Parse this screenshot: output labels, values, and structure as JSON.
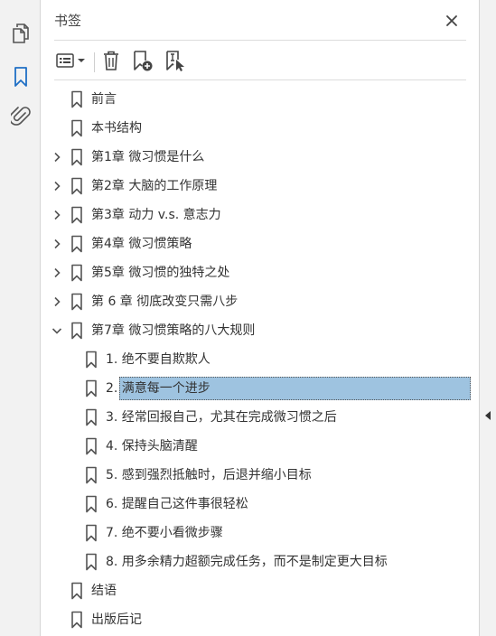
{
  "panel": {
    "title": "书签"
  },
  "toolbar": {
    "options_icon": "list-options-icon",
    "delete_icon": "trash-icon",
    "new_bookmark_icon": "new-bookmark-icon",
    "bookmark_from_selection_icon": "bookmark-selection-icon"
  },
  "left_rail": {
    "items": [
      {
        "icon": "pages-icon"
      },
      {
        "icon": "bookmark-icon",
        "active": true
      },
      {
        "icon": "attachment-icon"
      }
    ]
  },
  "colors": {
    "accent": "#1f6fc5",
    "selection": "#9ec3e0",
    "icon": "#444444"
  },
  "bookmarks": [
    {
      "label": "前言",
      "level": 0,
      "expander": "none"
    },
    {
      "label": "本书结构",
      "level": 0,
      "expander": "none"
    },
    {
      "label": "第1章 微习惯是什么",
      "level": 0,
      "expander": "collapsed"
    },
    {
      "label": "第2章 大脑的工作原理",
      "level": 0,
      "expander": "collapsed"
    },
    {
      "label": "第3章 动力 v.s. 意志力",
      "level": 0,
      "expander": "collapsed"
    },
    {
      "label": "第4章 微习惯策略",
      "level": 0,
      "expander": "collapsed"
    },
    {
      "label": "第5章 微习惯的独特之处",
      "level": 0,
      "expander": "collapsed"
    },
    {
      "label": "第 6 章 彻底改变只需八步",
      "level": 0,
      "expander": "collapsed"
    },
    {
      "label": "第7章 微习惯策略的八大规则",
      "level": 0,
      "expander": "expanded"
    },
    {
      "label": "1. 绝不要自欺欺人",
      "level": 1,
      "expander": "none"
    },
    {
      "label": "2. 满意每一个进步",
      "level": 1,
      "expander": "none",
      "selected": true
    },
    {
      "label": "3. 经常回报自己，尤其在完成微习惯之后",
      "level": 1,
      "expander": "none"
    },
    {
      "label": "4. 保持头脑清醒",
      "level": 1,
      "expander": "none"
    },
    {
      "label": "5. 感到强烈抵触时，后退并缩小目标",
      "level": 1,
      "expander": "none"
    },
    {
      "label": "6. 提醒自己这件事很轻松",
      "level": 1,
      "expander": "none"
    },
    {
      "label": "7. 绝不要小看微步骤",
      "level": 1,
      "expander": "none"
    },
    {
      "label": "8. 用多余精力超额完成任务，而不是制定更大目标",
      "level": 1,
      "expander": "none"
    },
    {
      "label": "结语",
      "level": 0,
      "expander": "none"
    },
    {
      "label": "出版后记",
      "level": 0,
      "expander": "none"
    }
  ]
}
